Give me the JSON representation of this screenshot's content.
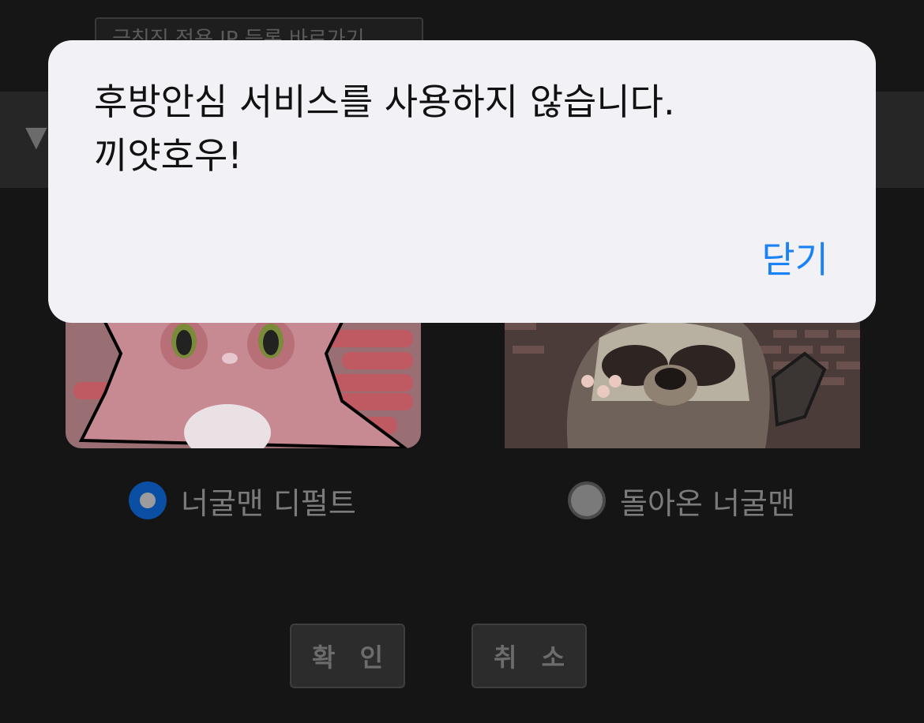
{
  "background_form": {
    "top_button_label": "금칙직 적용 IP 등록 바로가기",
    "options": [
      {
        "label": "너굴맨 디펄트",
        "selected": true
      },
      {
        "label": "돌아온 너굴맨",
        "selected": false
      }
    ],
    "confirm_label": "확 인",
    "cancel_label": "취 소"
  },
  "dialog": {
    "message": "후방안심 서비스를 사용하지 않습니다. 끼얏호우!",
    "close_label": "닫기"
  },
  "colors": {
    "dialog_bg": "#f2f1f6",
    "link_blue": "#1a82f7",
    "radio_selected": "#0a4fa4",
    "page_bg": "#151515"
  }
}
